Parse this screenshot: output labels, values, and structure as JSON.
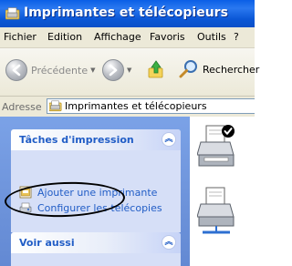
{
  "window": {
    "title": "Imprimantes et télécopieurs"
  },
  "menu": {
    "items": [
      {
        "label": "Fichier"
      },
      {
        "label": "Edition"
      },
      {
        "label": "Affichage"
      },
      {
        "label": "Favoris"
      },
      {
        "label": "Outils"
      },
      {
        "label": "?"
      }
    ]
  },
  "toolbar": {
    "back_label": "Précédente",
    "search_label": "Rechercher"
  },
  "address": {
    "label": "Adresse",
    "value": "Imprimantes et télécopieurs"
  },
  "tasks_panel": {
    "title": "Tâches d'impression",
    "items": [
      {
        "label": "Ajouter une imprimante",
        "icon": "add-printer-icon"
      },
      {
        "label": "Configurer les télécopies",
        "icon": "fax-icon"
      }
    ]
  },
  "see_also_panel": {
    "title": "Voir aussi"
  },
  "printers": [
    {
      "icon": "default-printer-icon",
      "default": true
    },
    {
      "icon": "shared-printer-icon",
      "default": false
    }
  ],
  "colors": {
    "title_bar": "#0b57d6",
    "task_pane_bg": "#6f95dc",
    "panel_bg": "#d6dff7",
    "link_text": "#215dc6"
  }
}
